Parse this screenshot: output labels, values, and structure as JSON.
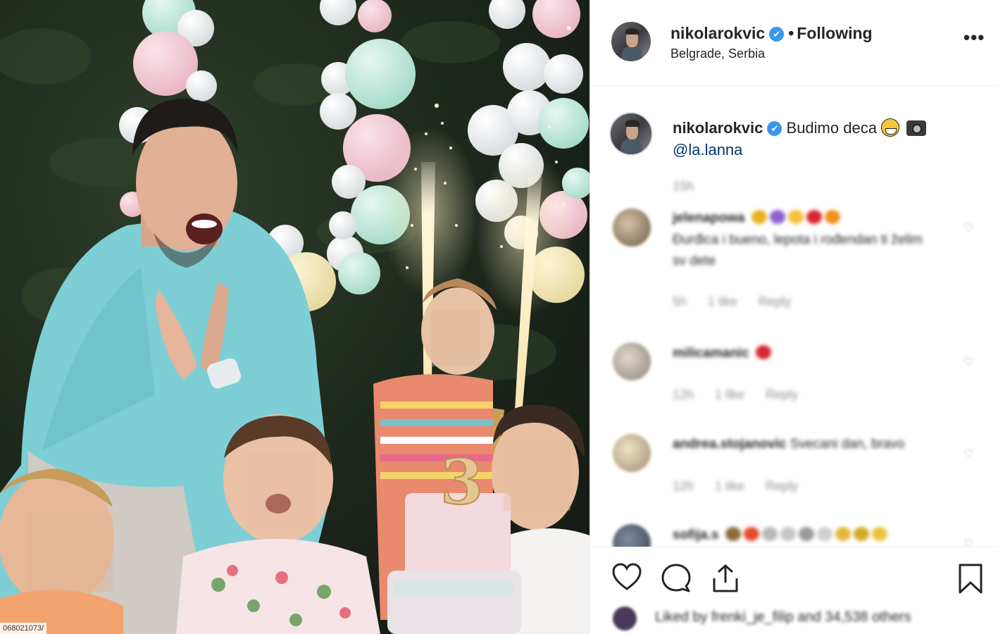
{
  "post": {
    "url_fragment": "068021073/"
  },
  "header": {
    "username": "nikolarokvic",
    "verified_badge": "✔",
    "separator": "•",
    "follow_status": "Following",
    "location": "Belgrade, Serbia",
    "more_label": "•••"
  },
  "caption": {
    "username": "nikolarokvic",
    "text": "Budimo deca",
    "emojis": [
      "grinning-face-icon",
      "camera-icon"
    ],
    "mention": "@la.lanna"
  },
  "time_ago": "15h",
  "comments": [
    {
      "username": "jelenapowa",
      "text": "Đurđica i bueno, lepota i rođendan ti želim",
      "line2": "sv dete",
      "time": "5h",
      "likes": "1 like",
      "reply": "Reply",
      "emojis": [
        "#e8b21c",
        "#8e5fd6",
        "#f2c13a",
        "#d8262f",
        "#f08f1c"
      ]
    },
    {
      "username": "milicamanic",
      "text": "",
      "time": "12h",
      "likes": "1 like",
      "reply": "Reply",
      "emojis": [
        "#d8262f"
      ]
    },
    {
      "username": "andrea.stojanovic",
      "text": "Svecani dan, bravo",
      "time": "12h",
      "likes": "1 like",
      "reply": "Reply",
      "emojis": []
    },
    {
      "username": "sofija.s",
      "text": "",
      "emojis": [
        "#8a6a3a",
        "#e44a2c",
        "#b8b8b8",
        "#c6c6c6",
        "#9a9a9a",
        "#d0d0d0",
        "#e2b83a",
        "#d4aa24",
        "#e8c43a"
      ]
    }
  ],
  "actions": {
    "like_icon": "heart-icon",
    "comment_icon": "comment-icon",
    "share_icon": "share-icon",
    "save_icon": "bookmark-icon"
  },
  "likes_summary": {
    "text": "Liked by frenki_je_filip and 34,538 others"
  },
  "colors": {
    "accent": "#3897f0",
    "mention": "#00376b",
    "muted": "#8e8e8e",
    "border": "#efefef"
  }
}
